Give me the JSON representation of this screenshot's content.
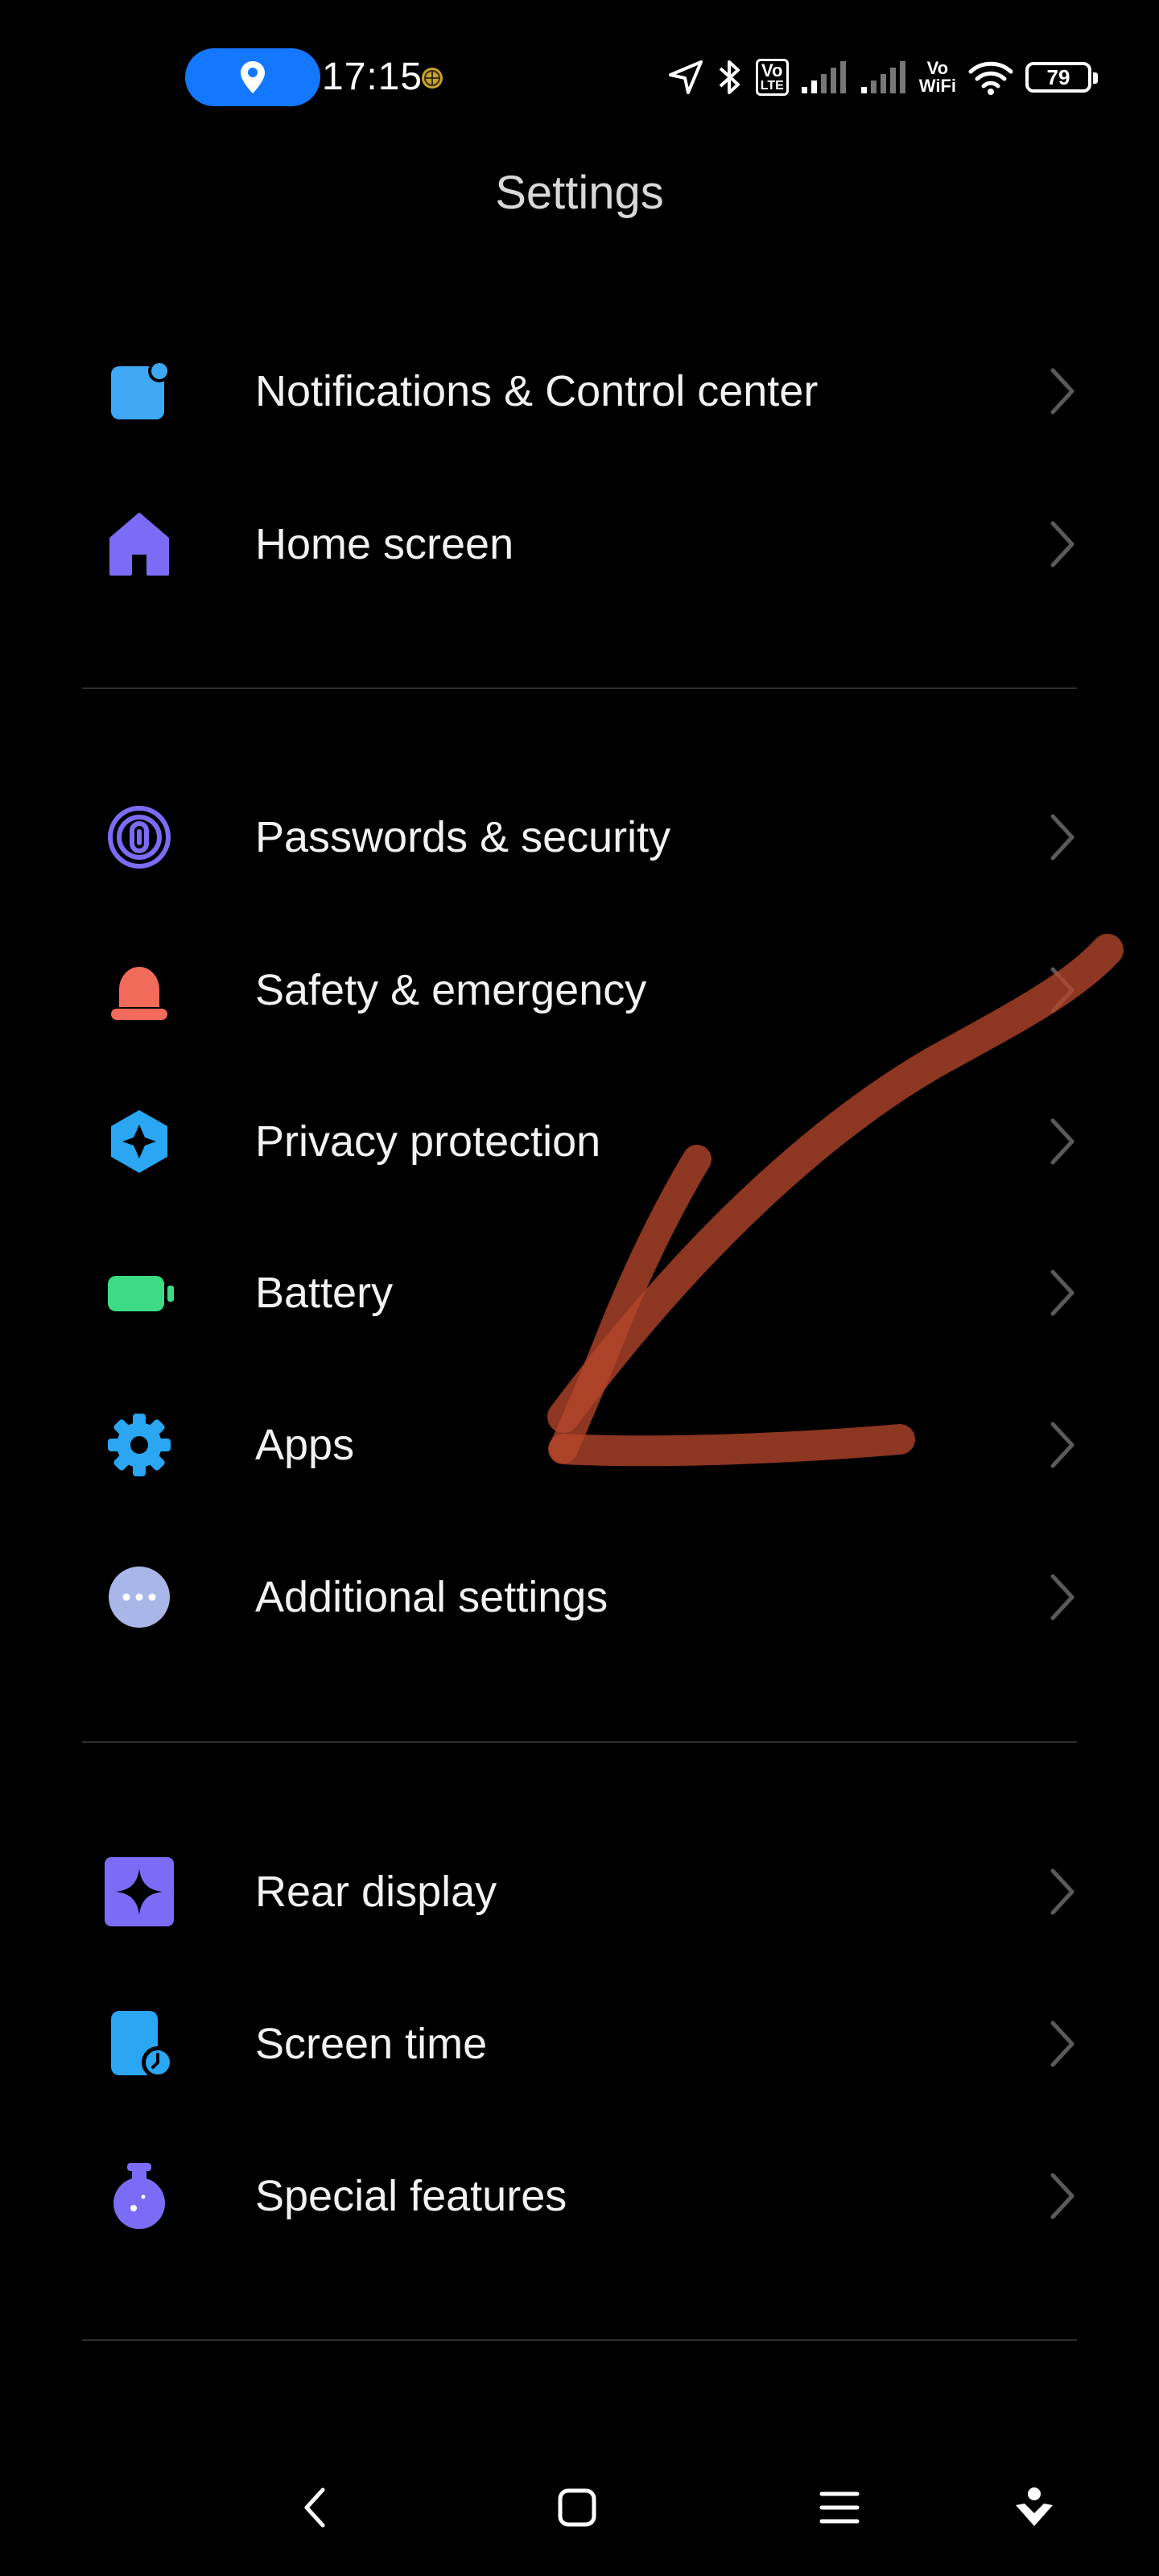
{
  "status_bar": {
    "time": "17:15",
    "volte_top": "Vo",
    "volte_bottom": "LTE",
    "vowifi_top": "Vo",
    "vowifi_bottom": "WiFi",
    "battery_level": "79",
    "location_pill_color": "#1477ff"
  },
  "header": {
    "title": "Settings"
  },
  "settings": {
    "group1": [
      {
        "label": "Notifications & Control center",
        "icon": "notification-icon",
        "color": "#3ea8f5"
      },
      {
        "label": "Home screen",
        "icon": "home-icon",
        "color": "#7c6cf5"
      }
    ],
    "group2": [
      {
        "label": "Passwords & security",
        "icon": "fingerprint-icon",
        "color": "#7c6cf5"
      },
      {
        "label": "Safety & emergency",
        "icon": "alarm-bell-icon",
        "color": "#f26a5a"
      },
      {
        "label": "Privacy protection",
        "icon": "privacy-shield-icon",
        "color": "#2aa6f2"
      },
      {
        "label": "Battery",
        "icon": "battery-icon",
        "color": "#3ddc84"
      },
      {
        "label": "Apps",
        "icon": "gear-icon",
        "color": "#2aa6f2"
      },
      {
        "label": "Additional settings",
        "icon": "more-dots-icon",
        "color": "#a8b6e8"
      }
    ],
    "group3": [
      {
        "label": "Rear display",
        "icon": "rear-display-icon",
        "color": "#7c6cf5"
      },
      {
        "label": "Screen time",
        "icon": "screen-time-icon",
        "color": "#2aa6f2"
      },
      {
        "label": "Special features",
        "icon": "special-features-icon",
        "color": "#7c6cf5"
      }
    ]
  },
  "annotation": {
    "color": "#b5452a",
    "points_to": "Apps"
  },
  "nav_bar": {
    "buttons": [
      "back-icon",
      "home-square-icon",
      "recents-menu-icon",
      "assistant-icon"
    ]
  }
}
